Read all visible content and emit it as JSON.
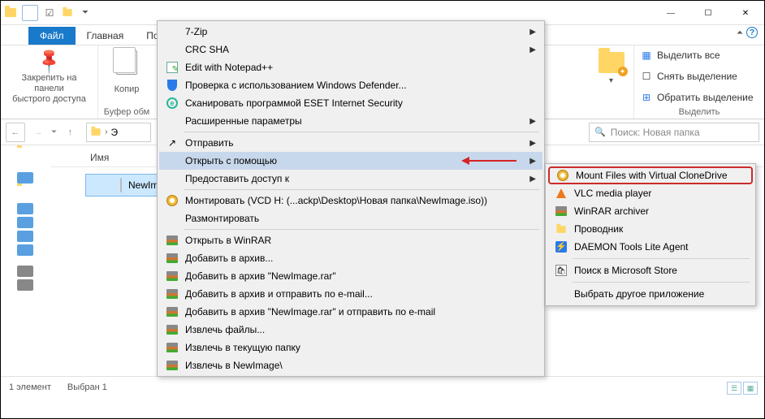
{
  "window": {
    "minimize": "—",
    "maximize": "☐",
    "close": "✕"
  },
  "tabs": {
    "file": "Файл",
    "home": "Главная",
    "po": "По"
  },
  "ribbon": {
    "pin": "Закрепить на панели\nбыстрого доступа",
    "copy": "Копир",
    "clipboard_label": "Буфер обм",
    "select_all": "Выделить все",
    "select_none": "Снять выделение",
    "invert": "Обратить выделение",
    "select_label": "Выделить"
  },
  "search": {
    "placeholder": "Поиск: Новая папка"
  },
  "columns": {
    "name": "Имя"
  },
  "files": {
    "selected": "NewImage"
  },
  "status": {
    "items": "1 элемент",
    "selected": "Выбран 1"
  },
  "context_menu": [
    {
      "label": "7-Zip",
      "sub": true
    },
    {
      "label": "CRC SHA",
      "sub": true
    },
    {
      "label": "Edit with Notepad++",
      "icon": "notepad"
    },
    {
      "label": "Проверка с использованием Windows Defender...",
      "icon": "shield"
    },
    {
      "label": "Сканировать программой ESET Internet Security",
      "icon": "eset"
    },
    {
      "label": "Расширенные параметры",
      "sub": true
    },
    {
      "sep": true
    },
    {
      "label": "Отправить",
      "sub": true,
      "icon": "share"
    },
    {
      "label": "Открыть с помощью",
      "sub": true,
      "hover": true
    },
    {
      "label": "Предоставить доступ к",
      "sub": true
    },
    {
      "sep": true
    },
    {
      "label": "Монтировать (VCD H: (...ackp\\Desktop\\Новая папка\\NewImage.iso))",
      "icon": "vcd"
    },
    {
      "label": "Размонтировать"
    },
    {
      "sep": true
    },
    {
      "label": "Открыть в WinRAR",
      "icon": "winrar"
    },
    {
      "label": "Добавить в архив...",
      "icon": "winrar"
    },
    {
      "label": "Добавить в архив \"NewImage.rar\"",
      "icon": "winrar"
    },
    {
      "label": "Добавить в архив и отправить по e-mail...",
      "icon": "winrar"
    },
    {
      "label": "Добавить в архив \"NewImage.rar\" и отправить по e-mail",
      "icon": "winrar"
    },
    {
      "label": "Извлечь файлы...",
      "icon": "winrar"
    },
    {
      "label": "Извлечь в текущую папку",
      "icon": "winrar"
    },
    {
      "label": "Извлечь в NewImage\\",
      "icon": "winrar"
    }
  ],
  "submenu": {
    "items": [
      {
        "label": "Mount Files with Virtual CloneDrive",
        "icon": "vcd",
        "highlight": true
      },
      {
        "label": "VLC media player",
        "icon": "vlc"
      },
      {
        "label": "WinRAR archiver",
        "icon": "winrar"
      },
      {
        "label": "Проводник",
        "icon": "folder"
      },
      {
        "label": "DAEMON Tools Lite Agent",
        "icon": "daemon"
      }
    ],
    "store": "Поиск в Microsoft Store",
    "other": "Выбрать другое приложение"
  }
}
